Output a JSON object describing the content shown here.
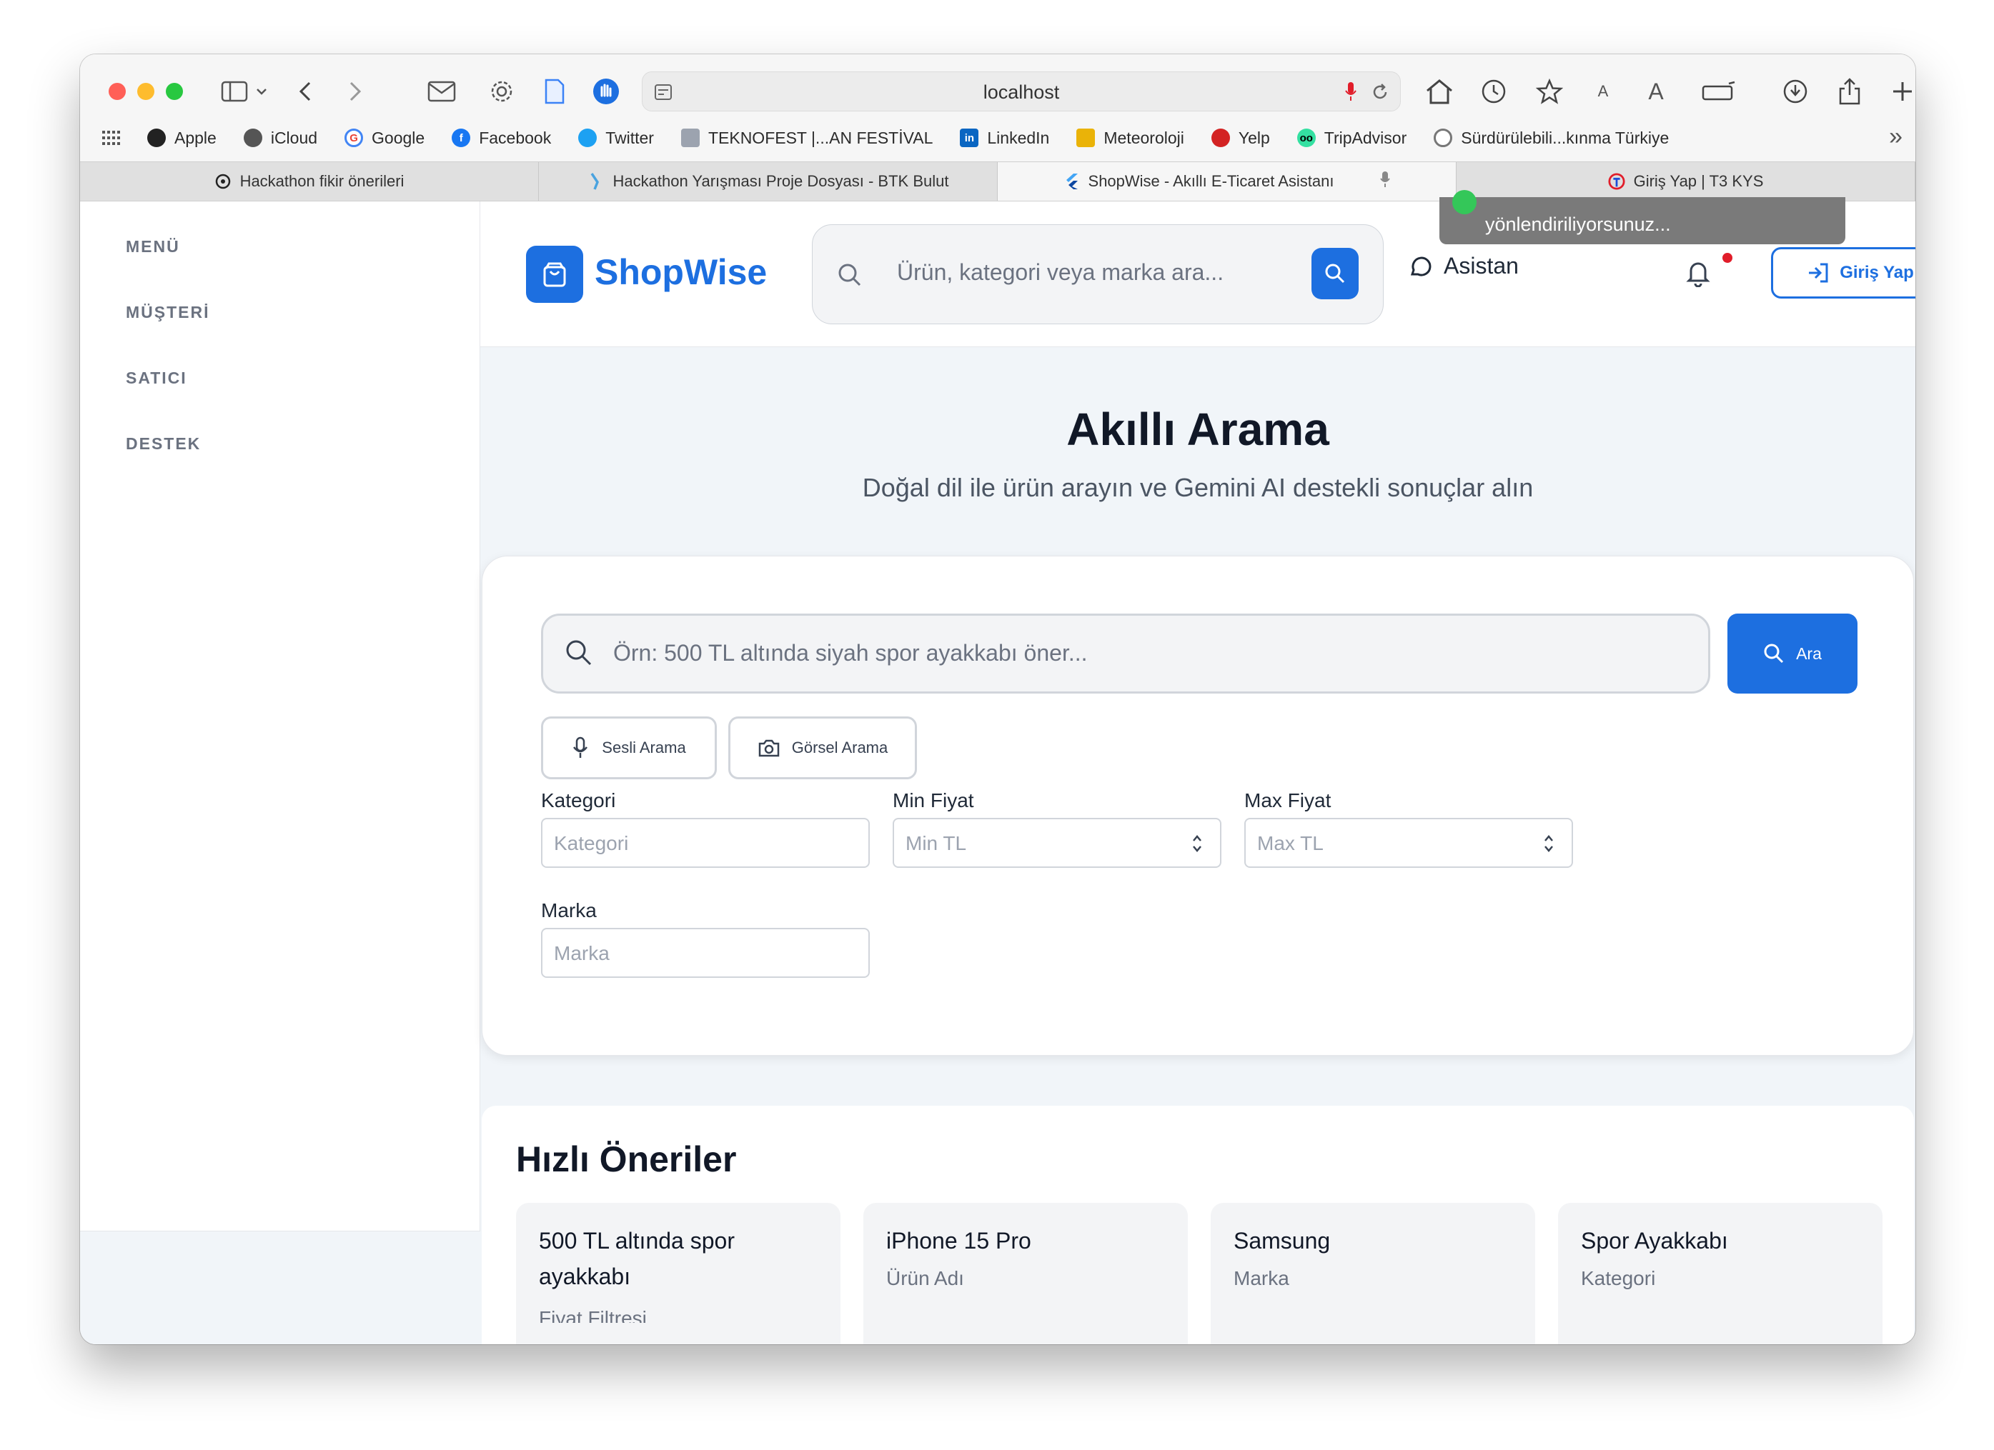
{
  "browser": {
    "url": "localhost",
    "bookmarks": [
      {
        "label": "Apple",
        "icon": "apple-icon"
      },
      {
        "label": "iCloud",
        "icon": "apple-icon"
      },
      {
        "label": "Google",
        "icon": "google-icon"
      },
      {
        "label": "Facebook",
        "icon": "facebook-icon"
      },
      {
        "label": "Twitter",
        "icon": "twitter-icon"
      },
      {
        "label": "TEKNOFEST |...AN FESTİVAL",
        "icon": "teknofest-icon"
      },
      {
        "label": "LinkedIn",
        "icon": "linkedin-icon"
      },
      {
        "label": "Meteoroloji",
        "icon": "meteoroloji-icon"
      },
      {
        "label": "Yelp",
        "icon": "yelp-icon"
      },
      {
        "label": "TripAdvisor",
        "icon": "tripadvisor-icon"
      },
      {
        "label": "Sürdürülebili...kınma Türkiye",
        "icon": "globe-icon"
      }
    ],
    "tabs": [
      {
        "label": "Hackathon fikir önerileri",
        "active": false
      },
      {
        "label": "Hackathon Yarışması Proje Dosyası - BTK Bulut",
        "active": false
      },
      {
        "label": "ShopWise - Akıllı E-Ticaret Asistanı",
        "active": true
      },
      {
        "label": "Giriş Yap | T3 KYS",
        "active": false
      }
    ]
  },
  "sidebar": {
    "items": [
      "MENÜ",
      "MÜŞTERİ",
      "SATICI",
      "DESTEK"
    ]
  },
  "header": {
    "brand": "ShopWise",
    "search_placeholder": "Ürün, kategori veya marka ara...",
    "assistant_label": "Asistan",
    "login_label": "Giriş Yap",
    "toast": "yönlendiriliyorsunuz..."
  },
  "main": {
    "title": "Akıllı Arama",
    "subtitle": "Doğal dil ile ürün arayın ve Gemini AI destekli sonuçlar alın",
    "search_placeholder": "Örn: 500 TL altında siyah spor ayakkabı öner...",
    "search_button": "Ara",
    "voice_search": "Sesli Arama",
    "visual_search": "Görsel Arama",
    "filters": {
      "category_label": "Kategori",
      "category_placeholder": "Kategori",
      "min_label": "Min Fiyat",
      "min_placeholder": "Min TL",
      "max_label": "Max Fiyat",
      "max_placeholder": "Max TL",
      "brand_label": "Marka",
      "brand_placeholder": "Marka"
    }
  },
  "quick": {
    "title": "Hızlı Öneriler",
    "items": [
      {
        "title": "500 TL altında spor ayakkabı",
        "subtitle": "Fiyat Filtresi"
      },
      {
        "title": "iPhone 15 Pro",
        "subtitle": "Ürün Adı"
      },
      {
        "title": "Samsung",
        "subtitle": "Marka"
      },
      {
        "title": "Spor Ayakkabı",
        "subtitle": "Kategori"
      }
    ]
  },
  "colors": {
    "accent": "#1d6fe0",
    "background": "#f1f5f9",
    "notification_dot": "#e11d2a"
  }
}
